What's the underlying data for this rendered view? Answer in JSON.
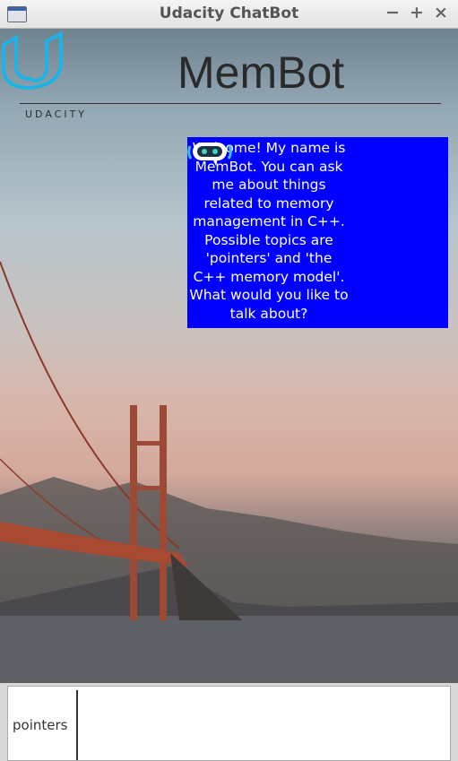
{
  "window": {
    "title": "Udacity ChatBot",
    "minimize": "−",
    "maximize": "+",
    "close": "×"
  },
  "header": {
    "logo_text": "UDACITY",
    "brand": "MemBot",
    "logo_color": "#1fb2e5"
  },
  "chat": {
    "messages": [
      {
        "sender": "bot",
        "text": "Welcome! My name is MemBot. You can ask me about things related to memory management in C++. Possible topics are 'pointers' and 'the C++ memory model'. What would you like to talk about?",
        "bubble_color": "#0000ff",
        "icon": "robot-icon"
      }
    ]
  },
  "input": {
    "value": "pointers"
  }
}
